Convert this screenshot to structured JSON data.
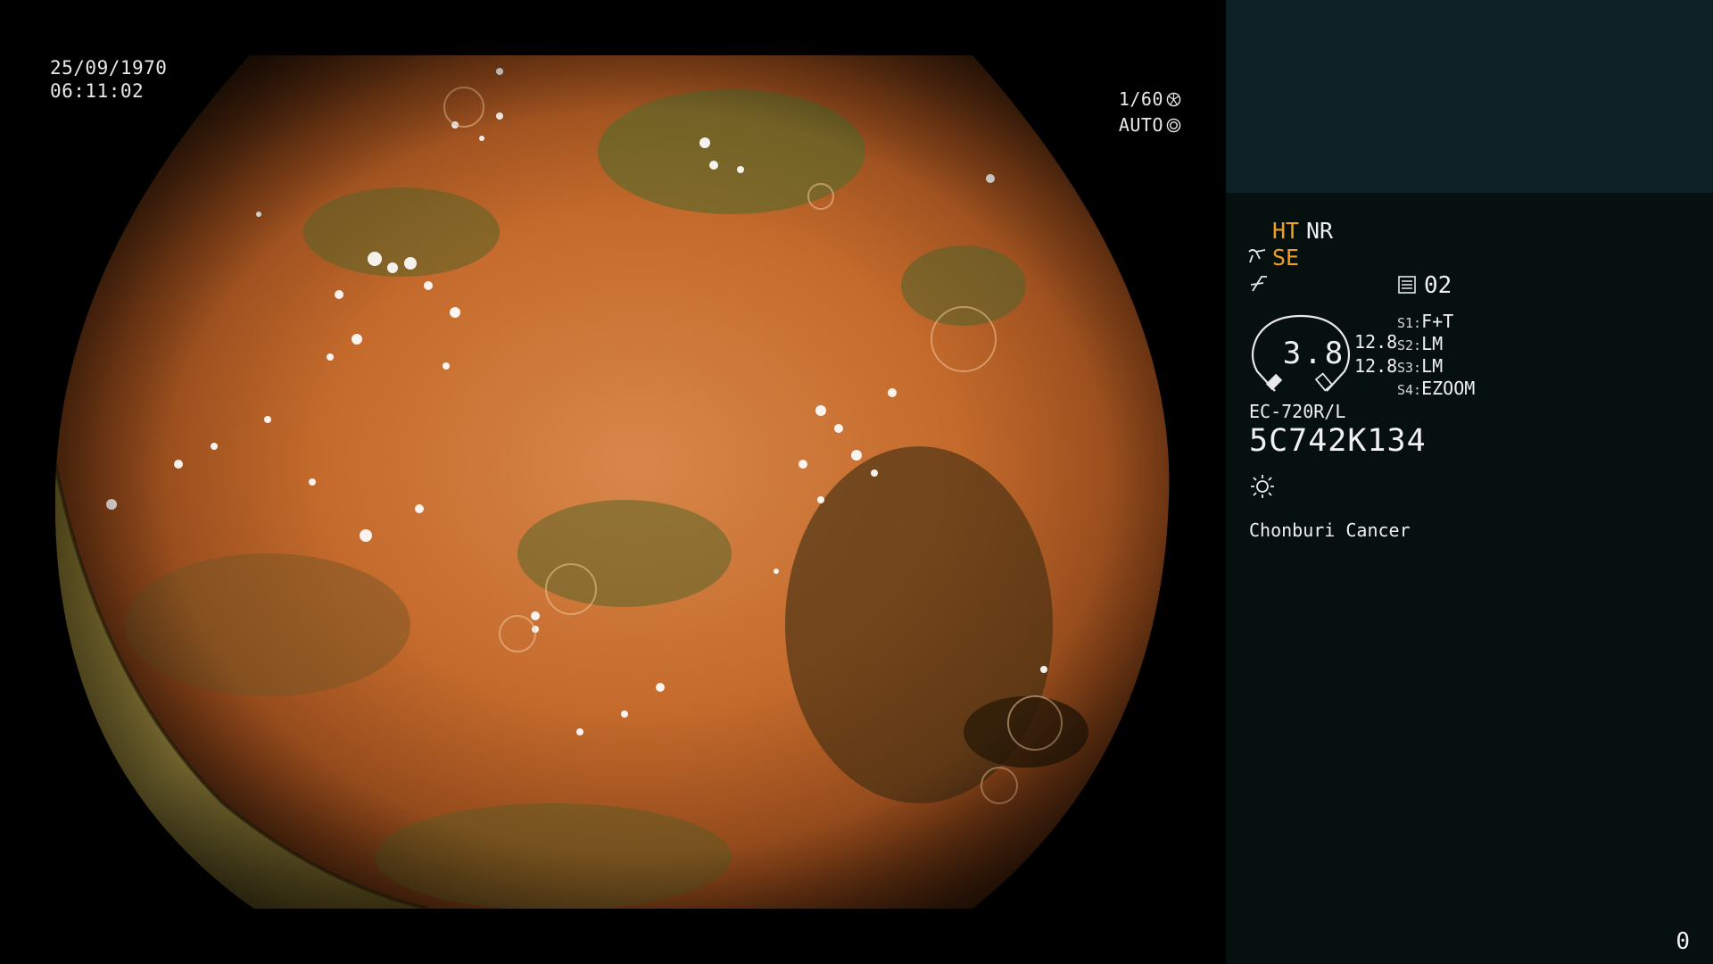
{
  "overlay": {
    "date": "25/09/1970",
    "time": "06:11:02",
    "shutter": "1/60",
    "exposure": "AUTO"
  },
  "panel": {
    "ht": "HT",
    "nr": "NR",
    "se": "SE",
    "mode_number": "02",
    "gauge_value": "3.8",
    "value_a": "12.8",
    "value_b": "12.8",
    "slots": [
      {
        "key": "S1:",
        "value": "F+T"
      },
      {
        "key": "S2:",
        "value": "LM"
      },
      {
        "key": "S3:",
        "value": "LM"
      },
      {
        "key": "S4:",
        "value": "EZOOM"
      }
    ],
    "scope_model": "EC-720R/L",
    "serial": "5C742K134",
    "hospital": "Chonburi Cancer",
    "counter": "0"
  },
  "colors": {
    "accent_orange": "#f0a020",
    "panel_top": "#0c2125",
    "panel_bg": "#06100f"
  }
}
